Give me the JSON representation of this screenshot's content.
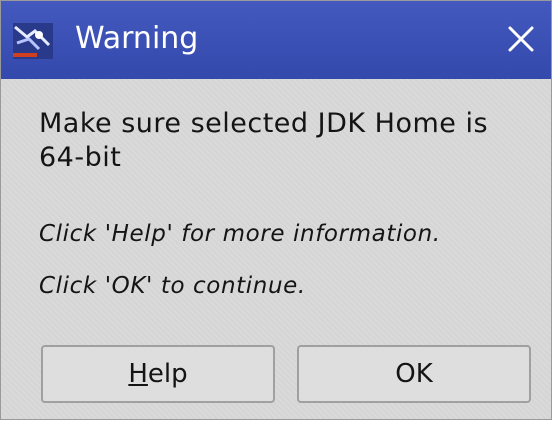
{
  "window": {
    "title": "Warning",
    "icon": "java-cup-icon",
    "close_icon": "close-icon",
    "titlebar_color": "#3d52b6"
  },
  "message": {
    "text": "Make sure selected JDK Home is 64-bit"
  },
  "hints": {
    "help_hint": "Click 'Help' for more information.",
    "ok_hint": "Click 'OK' to continue."
  },
  "buttons": {
    "help_mnemonic": "H",
    "help_rest": "elp",
    "ok_label": "OK"
  }
}
